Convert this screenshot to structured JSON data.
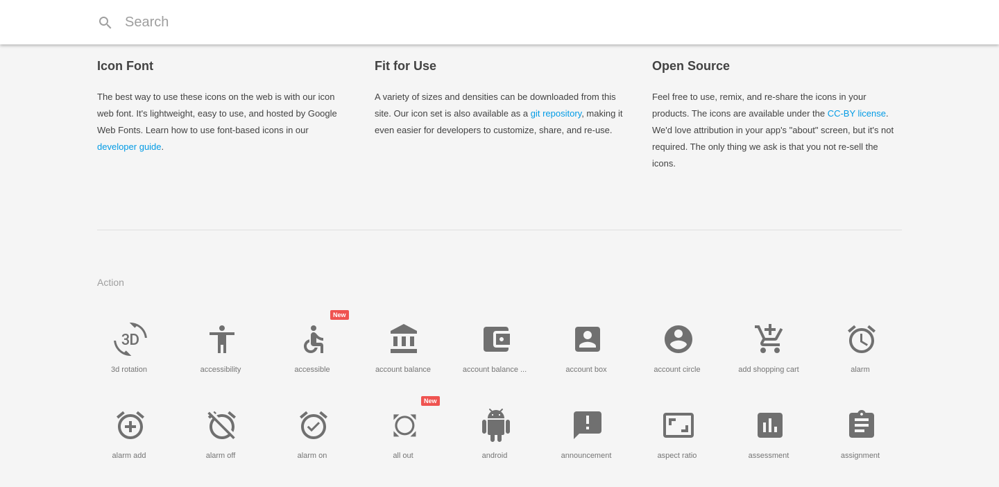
{
  "search": {
    "placeholder": "Search",
    "value": ""
  },
  "intro": [
    {
      "title": "Icon Font",
      "text_before": "The best way to use these icons on the web is with our icon web font. It's lightweight, easy to use, and hosted by Google Web Fonts. Learn how to use font-based icons in our ",
      "link": "developer guide",
      "text_after": "."
    },
    {
      "title": "Fit for Use",
      "text_before": "A variety of sizes and densities can be downloaded from this site. Our icon set is also available as a ",
      "link": "git repository",
      "text_after": ", making it even easier for developers to customize, share, and re-use."
    },
    {
      "title": "Open Source",
      "text_before": "Feel free to use, remix, and re-share the icons in your products. The icons are available under the ",
      "link": "CC-BY license",
      "text_after": ". We'd love attribution in your app's \"about\" screen, but it's not required. The only thing we ask is that you not re-sell the icons."
    }
  ],
  "section": {
    "title": "Action"
  },
  "badge_text": "New",
  "icons": [
    {
      "label": "3d rotation",
      "icon": "3d-rotation-icon",
      "new": false
    },
    {
      "label": "accessibility",
      "icon": "accessibility-icon",
      "new": false
    },
    {
      "label": "accessible",
      "icon": "accessible-icon",
      "new": true
    },
    {
      "label": "account balance",
      "icon": "account-balance-icon",
      "new": false
    },
    {
      "label": "account balance ...",
      "icon": "account-balance-wallet-icon",
      "new": false
    },
    {
      "label": "account box",
      "icon": "account-box-icon",
      "new": false
    },
    {
      "label": "account circle",
      "icon": "account-circle-icon",
      "new": false
    },
    {
      "label": "add shopping cart",
      "icon": "add-shopping-cart-icon",
      "new": false
    },
    {
      "label": "alarm",
      "icon": "alarm-icon",
      "new": false
    },
    {
      "label": "alarm add",
      "icon": "alarm-add-icon",
      "new": false
    },
    {
      "label": "alarm off",
      "icon": "alarm-off-icon",
      "new": false
    },
    {
      "label": "alarm on",
      "icon": "alarm-on-icon",
      "new": false
    },
    {
      "label": "all out",
      "icon": "all-out-icon",
      "new": true
    },
    {
      "label": "android",
      "icon": "android-icon",
      "new": false
    },
    {
      "label": "announcement",
      "icon": "announcement-icon",
      "new": false
    },
    {
      "label": "aspect ratio",
      "icon": "aspect-ratio-icon",
      "new": false
    },
    {
      "label": "assessment",
      "icon": "assessment-icon",
      "new": false
    },
    {
      "label": "assignment",
      "icon": "assignment-icon",
      "new": false
    }
  ]
}
